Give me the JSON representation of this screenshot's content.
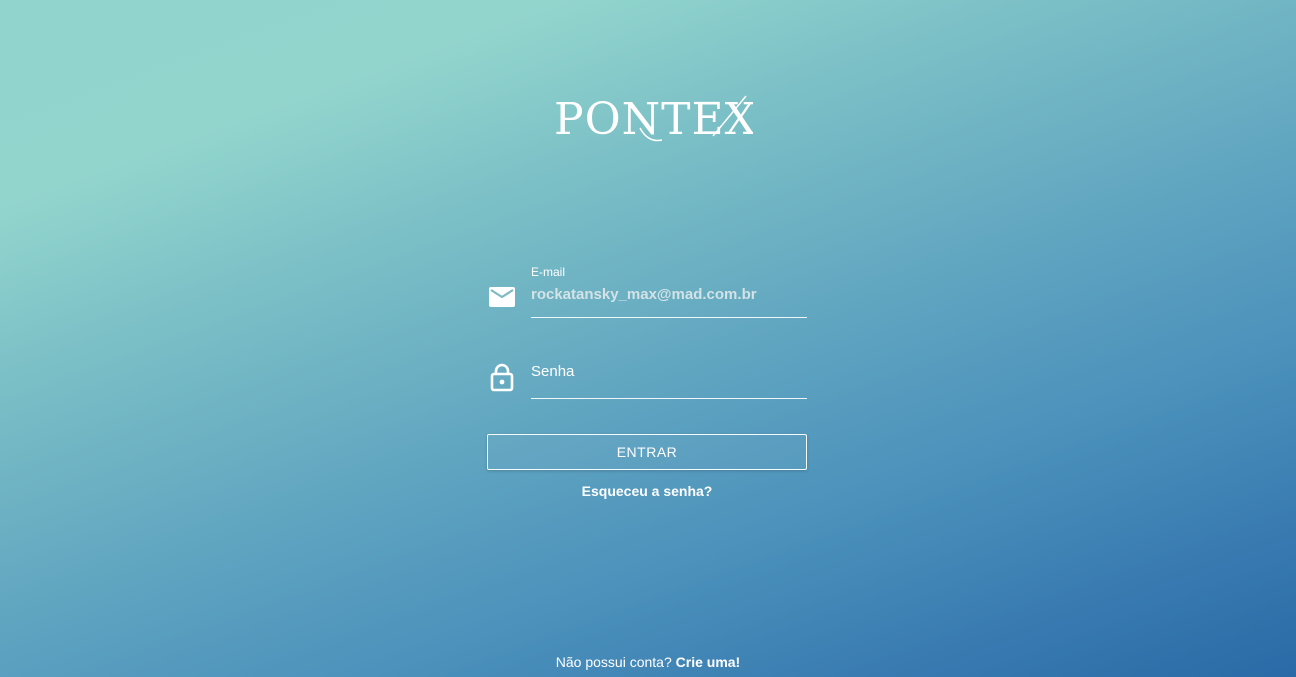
{
  "brand": {
    "logo_text": "PONTEX"
  },
  "form": {
    "email": {
      "label": "E-mail",
      "value": "rockatansky_max@mad.com.br",
      "icon": "mail-icon"
    },
    "password": {
      "placeholder": "Senha",
      "icon": "lock-icon"
    },
    "submit_label": "ENTRAR",
    "forgot_label": "Esqueceu a senha?"
  },
  "footer": {
    "signup_prompt": "Não possui conta?",
    "signup_link": "Crie uma!"
  },
  "colors": {
    "gradient_start": "#92d5cd",
    "gradient_end": "#2a6aa6",
    "text": "#ffffff"
  }
}
